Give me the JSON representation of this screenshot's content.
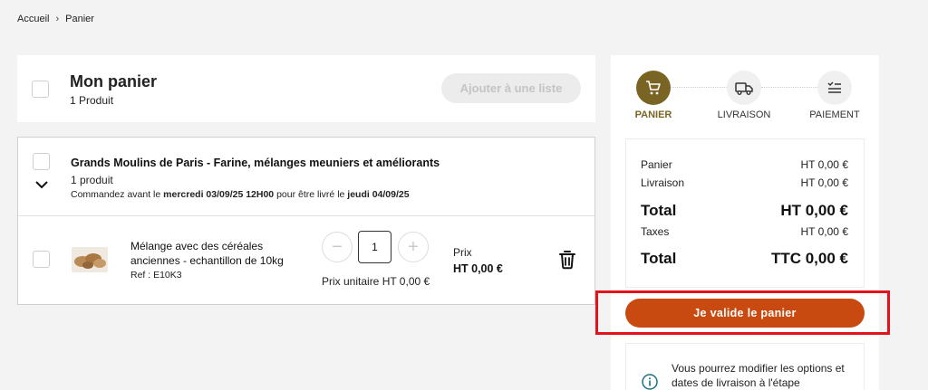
{
  "breadcrumb": {
    "home": "Accueil",
    "separator": "›",
    "current": "Panier"
  },
  "cart": {
    "title": "Mon panier",
    "count": "1 Produit",
    "add_to_list": "Ajouter à une liste"
  },
  "supplier": {
    "name": "Grands Moulins de Paris - Farine, mélanges meuniers et améliorants",
    "count": "1 produit",
    "order_prefix": "Commandez avant le",
    "order_deadline": "mercredi 03/09/25 12H00",
    "order_middle": "pour être livré le",
    "delivery_date": "jeudi 04/09/25"
  },
  "product": {
    "name": "Mélange avec des céréales anciennes - echantillon de 10kg",
    "ref": "Ref : E10K3",
    "quantity": "1",
    "minus": "−",
    "plus": "+",
    "unit_price": "Prix unitaire HT 0,00 €",
    "price_label": "Prix",
    "price_value": "HT 0,00 €"
  },
  "steps": [
    {
      "label": "PANIER",
      "icon": "cart-icon",
      "active": true
    },
    {
      "label": "LIVRAISON",
      "icon": "truck-icon",
      "active": false
    },
    {
      "label": "PAIEMENT",
      "icon": "checklist-icon",
      "active": false
    }
  ],
  "summary": {
    "panier_label": "Panier",
    "panier_value": "HT 0,00 €",
    "livraison_label": "Livraison",
    "livraison_value": "HT 0,00 €",
    "total_ht_label": "Total",
    "total_ht_value": "HT 0,00 €",
    "taxes_label": "Taxes",
    "taxes_value": "HT 0,00 €",
    "total_ttc_label": "Total",
    "total_ttc_value": "TTC 0,00 €"
  },
  "validate_button": "Je valide le panier",
  "info_text": "Vous pourrez modifier les options et dates de livraison à l'étape",
  "colors": {
    "accent": "#7a6424",
    "validate": "#c94a10",
    "highlight": "#e3121b"
  }
}
